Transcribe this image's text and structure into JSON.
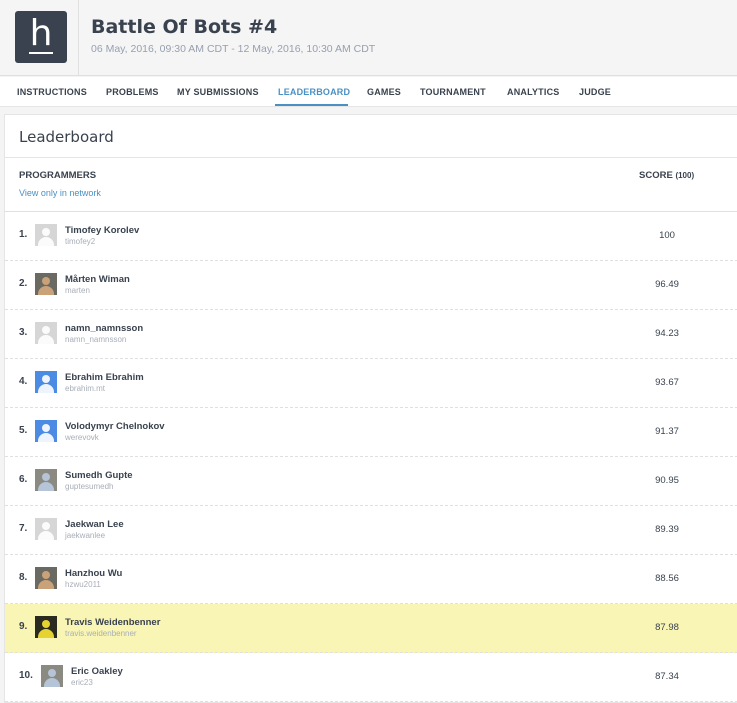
{
  "header": {
    "logo_letter": "h",
    "title": "Battle Of Bots #4",
    "dates": "06 May, 2016, 09:30 AM CDT - 12 May, 2016, 10:30 AM CDT"
  },
  "nav": {
    "items": [
      {
        "label": "INSTRUCTIONS"
      },
      {
        "label": "PROBLEMS"
      },
      {
        "label": "MY SUBMISSIONS"
      },
      {
        "label": "LEADERBOARD"
      },
      {
        "label": "GAMES"
      },
      {
        "label": "TOURNAMENT"
      },
      {
        "label": "ANALYTICS"
      },
      {
        "label": "JUDGE"
      }
    ],
    "active": "LEADERBOARD"
  },
  "leaderboard": {
    "title": "Leaderboard",
    "programmers_header": "PROGRAMMERS",
    "network_filter_link": "View only in network",
    "score_header": "SCORE",
    "score_max": "(100)",
    "rows": [
      {
        "rank": "1.",
        "name": "Timofey Korolev",
        "handle": "timofey2",
        "score": "100",
        "avatar": "default-avatar-icon"
      },
      {
        "rank": "2.",
        "name": "Mårten Wiman",
        "handle": "marten",
        "score": "96.49",
        "avatar": "user-photo"
      },
      {
        "rank": "3.",
        "name": "namn_namnsson",
        "handle": "namn_namnsson",
        "score": "94.23",
        "avatar": "default-avatar-icon"
      },
      {
        "rank": "4.",
        "name": "Ebrahim Ebrahim",
        "handle": "ebrahim.mt",
        "score": "93.67",
        "avatar": "blue-avatar-icon"
      },
      {
        "rank": "5.",
        "name": "Volodymyr Chelnokov",
        "handle": "werevovk",
        "score": "91.37",
        "avatar": "blue-avatar-icon"
      },
      {
        "rank": "6.",
        "name": "Sumedh Gupte",
        "handle": "guptesumedh",
        "score": "90.95",
        "avatar": "user-photo"
      },
      {
        "rank": "7.",
        "name": "Jaekwan Lee",
        "handle": "jaekwanlee",
        "score": "89.39",
        "avatar": "default-avatar-icon"
      },
      {
        "rank": "8.",
        "name": "Hanzhou Wu",
        "handle": "hzwu2011",
        "score": "88.56",
        "avatar": "user-photo"
      },
      {
        "rank": "9.",
        "name": "Travis Weidenbenner",
        "handle": "travis.weidenbenner",
        "score": "87.98",
        "avatar": "user-photo",
        "highlighted": true
      },
      {
        "rank": "10.",
        "name": "Eric Oakley",
        "handle": "eric23",
        "score": "87.34",
        "avatar": "user-photo"
      }
    ]
  },
  "colors": {
    "brand": "#39424e",
    "link": "#4a90c2",
    "highlight_row": "#f9f5b4"
  }
}
